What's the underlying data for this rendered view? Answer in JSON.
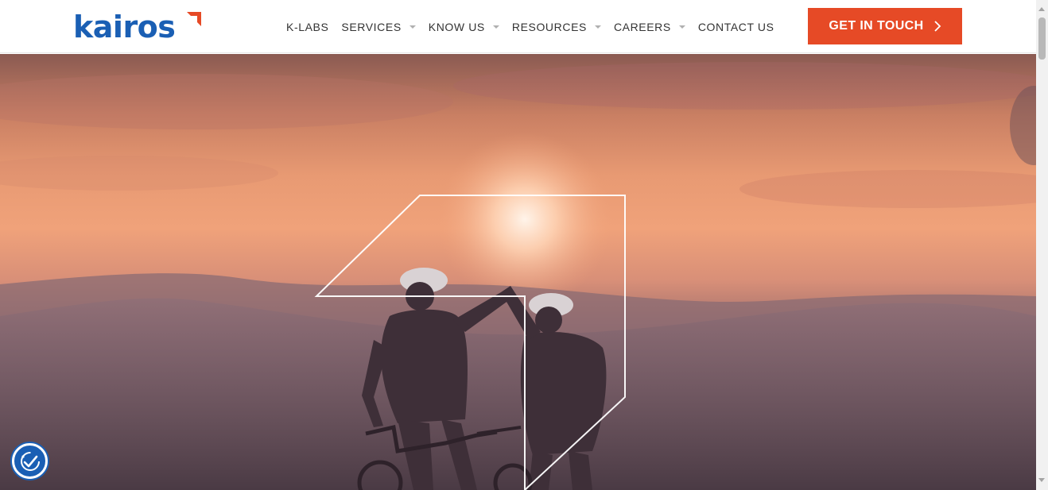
{
  "brand": {
    "logo_text": "kairos",
    "logo_color": "#1a5fb4",
    "accent_color": "#e64a26"
  },
  "nav": {
    "items": [
      {
        "label": "K-LABS",
        "has_dropdown": false
      },
      {
        "label": "SERVICES",
        "has_dropdown": true
      },
      {
        "label": "KNOW US",
        "has_dropdown": true
      },
      {
        "label": "RESOURCES",
        "has_dropdown": true
      },
      {
        "label": "CAREERS",
        "has_dropdown": true
      },
      {
        "label": "CONTACT US",
        "has_dropdown": false
      }
    ]
  },
  "cta": {
    "label": "GET IN TOUCH",
    "icon": "chevron-right-icon"
  },
  "hero": {
    "image": "two cyclists high-fiving at sunset over mountains",
    "overlay_icon": "kairos-outline-mark"
  },
  "accessibility": {
    "icon": "accessibility-icon"
  }
}
